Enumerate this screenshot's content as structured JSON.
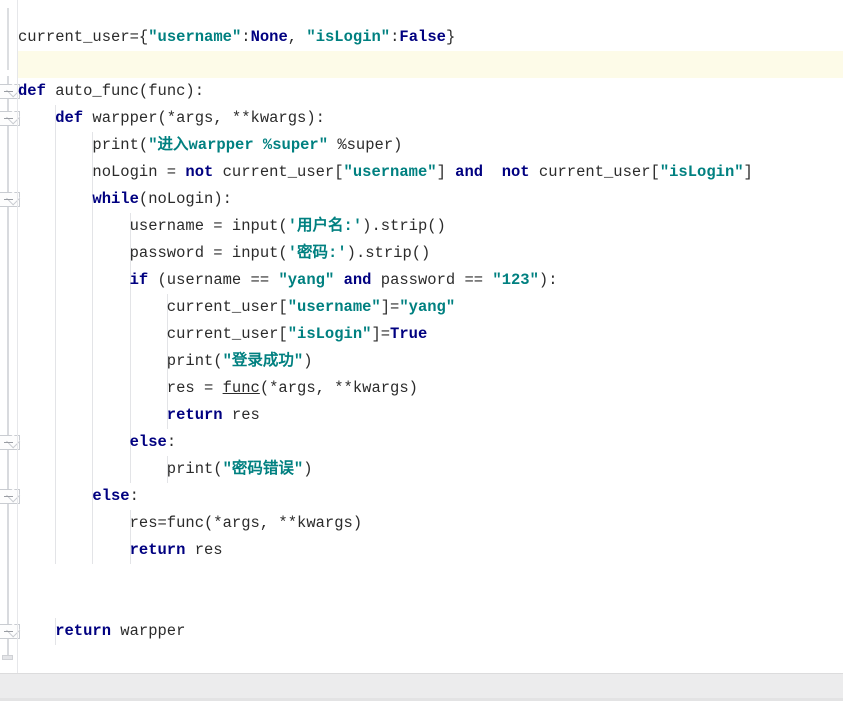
{
  "window": {
    "kind": "code-editor-pane",
    "language": "Python",
    "background_color": "#ffffff",
    "highlight_line_color": "#fdfbe8",
    "status_bar_color": "#ececed",
    "keyword_color": "#000080",
    "string_color": "#008080",
    "text_color": "#2b2b2b",
    "gutter_color": "#ffffff",
    "indent_guide_color": "#e3e4e7"
  },
  "editor": {
    "caret_line_index": 1,
    "fold_marker_icon": "fold-collapse-icon",
    "lines": [
      {
        "indent": 0,
        "highlight": false,
        "fold": false,
        "tokens": [
          {
            "t": "plain",
            "v": "current_user={"
          },
          {
            "t": "str",
            "v": "″username″"
          },
          {
            "t": "plain",
            "v": ":"
          },
          {
            "t": "lit",
            "v": "None"
          },
          {
            "t": "plain",
            "v": ", "
          },
          {
            "t": "str",
            "v": "″isLogin″"
          },
          {
            "t": "plain",
            "v": ":"
          },
          {
            "t": "lit",
            "v": "False"
          },
          {
            "t": "plain",
            "v": "}"
          }
        ]
      },
      {
        "indent": 0,
        "highlight": true,
        "fold": false,
        "tokens": []
      },
      {
        "indent": 0,
        "highlight": false,
        "fold": true,
        "fold_tip": true,
        "tokens": [
          {
            "t": "kw",
            "v": "def"
          },
          {
            "t": "plain",
            "v": " auto_func(func):"
          }
        ]
      },
      {
        "indent": 1,
        "highlight": false,
        "fold": true,
        "fold_tip": true,
        "tokens": [
          {
            "t": "kw",
            "v": "def"
          },
          {
            "t": "plain",
            "v": " warpper(*args, **kwargs):"
          }
        ]
      },
      {
        "indent": 2,
        "highlight": false,
        "fold": false,
        "tokens": [
          {
            "t": "plain",
            "v": "print("
          },
          {
            "t": "str",
            "v": "″进入warpper %super″"
          },
          {
            "t": "plain",
            "v": " %super)"
          }
        ]
      },
      {
        "indent": 2,
        "highlight": false,
        "fold": false,
        "tokens": [
          {
            "t": "plain",
            "v": "noLogin = "
          },
          {
            "t": "kw",
            "v": "not"
          },
          {
            "t": "plain",
            "v": " current_user["
          },
          {
            "t": "str",
            "v": "″username″"
          },
          {
            "t": "plain",
            "v": "] "
          },
          {
            "t": "kw",
            "v": "and"
          },
          {
            "t": "plain",
            "v": "  "
          },
          {
            "t": "kw",
            "v": "not"
          },
          {
            "t": "plain",
            "v": " current_user["
          },
          {
            "t": "str",
            "v": "″isLogin″"
          },
          {
            "t": "plain",
            "v": "]"
          }
        ]
      },
      {
        "indent": 2,
        "highlight": false,
        "fold": true,
        "fold_tip": true,
        "tokens": [
          {
            "t": "kw",
            "v": "while"
          },
          {
            "t": "plain",
            "v": "(noLogin):"
          }
        ]
      },
      {
        "indent": 3,
        "highlight": false,
        "fold": false,
        "tokens": [
          {
            "t": "plain",
            "v": "username = input("
          },
          {
            "t": "str",
            "v": "'用户名:'"
          },
          {
            "t": "plain",
            "v": ").strip()"
          }
        ]
      },
      {
        "indent": 3,
        "highlight": false,
        "fold": false,
        "tokens": [
          {
            "t": "plain",
            "v": "password = input("
          },
          {
            "t": "str",
            "v": "'密码:'"
          },
          {
            "t": "plain",
            "v": ").strip()"
          }
        ]
      },
      {
        "indent": 3,
        "highlight": false,
        "fold": false,
        "tokens": [
          {
            "t": "kw",
            "v": "if"
          },
          {
            "t": "plain",
            "v": " (username == "
          },
          {
            "t": "str",
            "v": "″yang″"
          },
          {
            "t": "plain",
            "v": " "
          },
          {
            "t": "kw",
            "v": "and"
          },
          {
            "t": "plain",
            "v": " password == "
          },
          {
            "t": "str",
            "v": "″123″"
          },
          {
            "t": "plain",
            "v": "):"
          }
        ]
      },
      {
        "indent": 4,
        "highlight": false,
        "fold": false,
        "tokens": [
          {
            "t": "plain",
            "v": "current_user["
          },
          {
            "t": "str",
            "v": "″username″"
          },
          {
            "t": "plain",
            "v": "]="
          },
          {
            "t": "str",
            "v": "″yang″"
          }
        ]
      },
      {
        "indent": 4,
        "highlight": false,
        "fold": false,
        "tokens": [
          {
            "t": "plain",
            "v": "current_user["
          },
          {
            "t": "str",
            "v": "″isLogin″"
          },
          {
            "t": "plain",
            "v": "]="
          },
          {
            "t": "lit",
            "v": "True"
          }
        ]
      },
      {
        "indent": 4,
        "highlight": false,
        "fold": false,
        "tokens": [
          {
            "t": "plain",
            "v": "print("
          },
          {
            "t": "str",
            "v": "″登录成功″"
          },
          {
            "t": "plain",
            "v": ")"
          }
        ]
      },
      {
        "indent": 4,
        "highlight": false,
        "fold": false,
        "tokens": [
          {
            "t": "plain",
            "v": "res = "
          },
          {
            "t": "fnlink",
            "v": "func"
          },
          {
            "t": "plain",
            "v": "(*args, **kwargs)"
          }
        ]
      },
      {
        "indent": 4,
        "highlight": false,
        "fold": false,
        "tokens": [
          {
            "t": "kw",
            "v": "return"
          },
          {
            "t": "plain",
            "v": " res"
          }
        ]
      },
      {
        "indent": 3,
        "highlight": false,
        "fold": true,
        "fold_tip": true,
        "tokens": [
          {
            "t": "kw",
            "v": "else"
          },
          {
            "t": "plain",
            "v": ":"
          }
        ]
      },
      {
        "indent": 4,
        "highlight": false,
        "fold": false,
        "tokens": [
          {
            "t": "plain",
            "v": "print("
          },
          {
            "t": "str",
            "v": "″密码错误″"
          },
          {
            "t": "plain",
            "v": ")"
          }
        ]
      },
      {
        "indent": 2,
        "highlight": false,
        "fold": true,
        "fold_tip": true,
        "tokens": [
          {
            "t": "kw",
            "v": "else"
          },
          {
            "t": "plain",
            "v": ":"
          }
        ]
      },
      {
        "indent": 3,
        "highlight": false,
        "fold": false,
        "tokens": [
          {
            "t": "plain",
            "v": "res=func(*args, **kwargs)"
          }
        ]
      },
      {
        "indent": 3,
        "highlight": false,
        "fold": false,
        "tokens": [
          {
            "t": "kw",
            "v": "return"
          },
          {
            "t": "plain",
            "v": " res"
          }
        ]
      },
      {
        "indent": 0,
        "highlight": false,
        "fold": false,
        "tokens": []
      },
      {
        "indent": 0,
        "highlight": false,
        "fold": false,
        "tokens": []
      },
      {
        "indent": 1,
        "highlight": false,
        "fold": true,
        "fold_tip": true,
        "tokens": [
          {
            "t": "kw",
            "v": "return"
          },
          {
            "t": "plain",
            "v": " warpper"
          }
        ]
      }
    ]
  },
  "status_bar": {
    "text": ""
  }
}
